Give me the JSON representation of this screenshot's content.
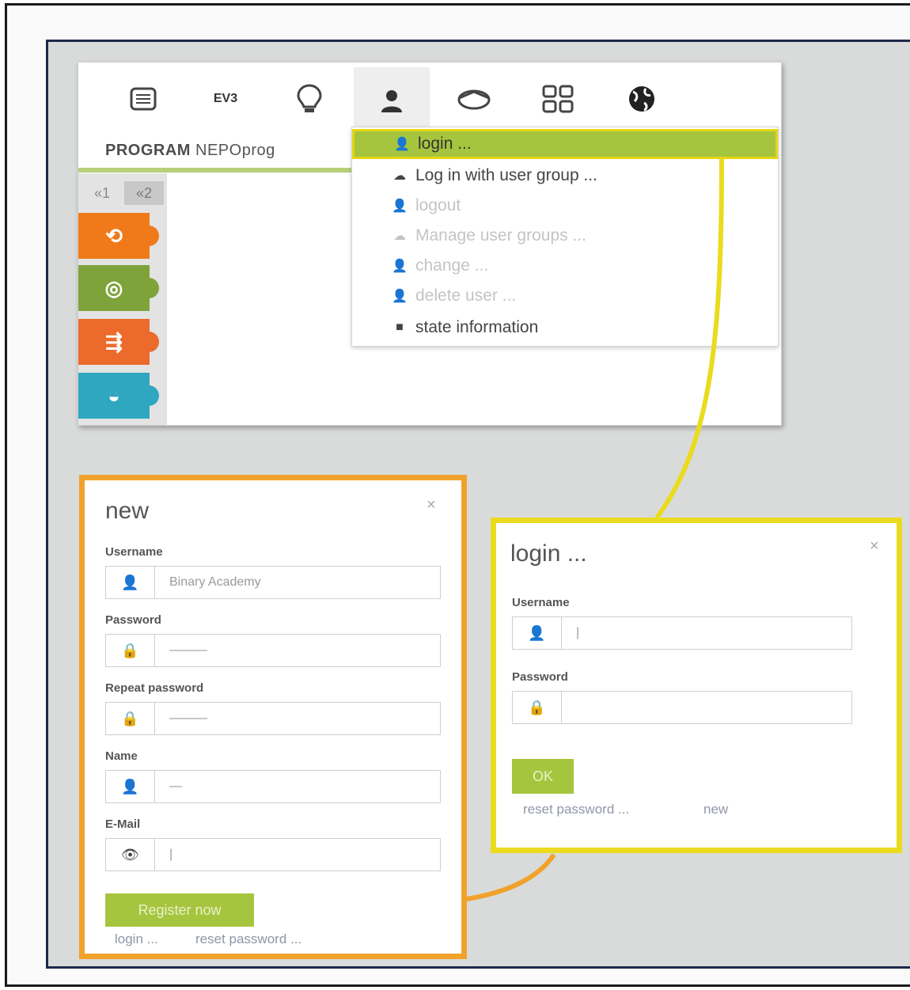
{
  "toolbar": {
    "icons": [
      {
        "name": "program-icon",
        "glyph": "▦"
      },
      {
        "name": "robot-ev3-icon",
        "label": "EV3"
      },
      {
        "name": "lightbulb-icon",
        "glyph": "💡"
      },
      {
        "name": "user-icon",
        "glyph": "👤"
      },
      {
        "name": "graduation-cap-icon",
        "glyph": "🎓"
      },
      {
        "name": "gallery-icon",
        "glyph": "▦"
      },
      {
        "name": "globe-icon",
        "glyph": "◕"
      }
    ]
  },
  "program_tab": {
    "prefix": "PROGRAM",
    "name": "NEPOprog"
  },
  "level_tabs": [
    "«1",
    "«2"
  ],
  "blocks": [
    {
      "name": "action-block",
      "glyph": "⟲",
      "color": "#f07a1a"
    },
    {
      "name": "sensor-block",
      "glyph": "◎",
      "color": "#7ea33a"
    },
    {
      "name": "control-block",
      "glyph": "⇶",
      "color": "#ec6a2b"
    },
    {
      "name": "logic-block",
      "glyph": "◒",
      "color": "#2fa7c0"
    }
  ],
  "user_menu": {
    "items": [
      {
        "label": "login ...",
        "icon": "👤",
        "state": "selected"
      },
      {
        "label": "Log in with user group ...",
        "icon": "☁",
        "state": "enabled"
      },
      {
        "label": "logout",
        "icon": "👤",
        "state": "disabled"
      },
      {
        "label": "Manage user groups ...",
        "icon": "☁",
        "state": "disabled"
      },
      {
        "label": "change ...",
        "icon": "👤",
        "state": "disabled"
      },
      {
        "label": "delete user ...",
        "icon": "👤",
        "state": "disabled"
      },
      {
        "label": "state information",
        "icon": "■",
        "state": "enabled"
      }
    ]
  },
  "register_dialog": {
    "title": "new",
    "close": "×",
    "fields": [
      {
        "label": "Username",
        "value": "Binary Academy",
        "icon": "👤"
      },
      {
        "label": "Password",
        "value": "———",
        "icon": "🔒"
      },
      {
        "label": "Repeat password",
        "value": "———",
        "icon": "🔒"
      },
      {
        "label": "Name",
        "value": "—",
        "icon": "👤"
      },
      {
        "label": "E-Mail",
        "value": "|",
        "icon": "👁"
      }
    ],
    "button": "Register now",
    "links": [
      "login ...",
      "reset password ..."
    ]
  },
  "login_dialog": {
    "title": "login ...",
    "close": "×",
    "fields": [
      {
        "label": "Username",
        "value": "|",
        "icon": "👤"
      },
      {
        "label": "Password",
        "value": "",
        "icon": "🔒"
      }
    ],
    "button": "OK",
    "links": [
      "reset password ...",
      "new"
    ]
  },
  "colors": {
    "accent_green": "#a6c53e",
    "highlight_yellow": "#eadb1f",
    "highlight_orange": "#f0a22a"
  }
}
